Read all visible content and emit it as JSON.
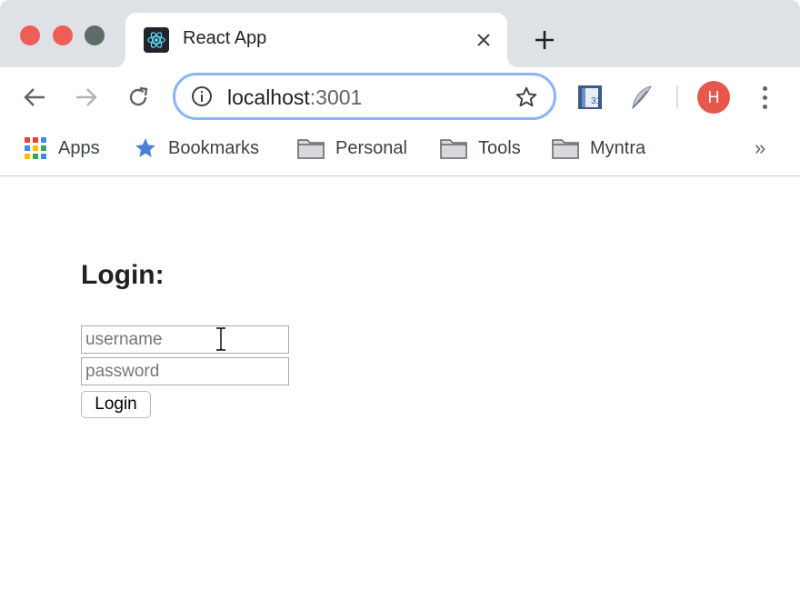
{
  "browser": {
    "tab": {
      "title": "React App",
      "favicon": "react-logo-icon"
    },
    "new_tab_icon": "plus-icon",
    "address_bar": {
      "host": "localhost",
      "port": ":3001"
    },
    "avatar_initial": "H",
    "extensions": [
      "calendar-extension-icon",
      "feather-extension-icon"
    ]
  },
  "bookmarks": {
    "items": [
      {
        "label": "Apps",
        "icon": "apps-grid-icon"
      },
      {
        "label": "Bookmarks",
        "icon": "star-icon"
      },
      {
        "label": "Personal",
        "icon": "folder-icon"
      },
      {
        "label": "Tools",
        "icon": "folder-icon"
      },
      {
        "label": "Myntra",
        "icon": "folder-icon"
      }
    ],
    "overflow": "»"
  },
  "page": {
    "heading": "Login:",
    "username_placeholder": "username",
    "password_placeholder": "password",
    "submit_label": "Login"
  },
  "colors": {
    "tabstrip": "#dee1e6",
    "omnibox_focus": "#8ab4f8",
    "avatar": "#e8574c",
    "traffic_red": "#ee5e57"
  }
}
